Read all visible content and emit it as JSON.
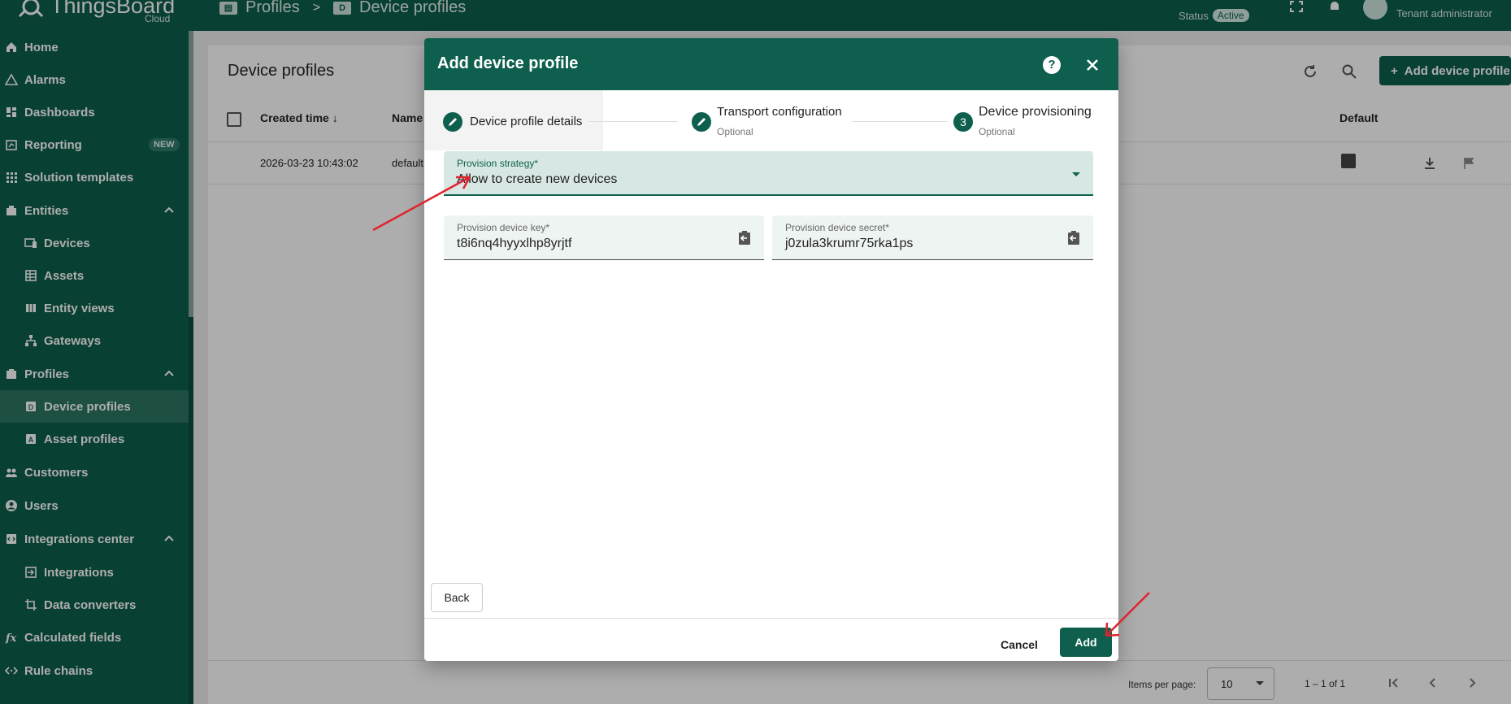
{
  "app": {
    "logo_text": "ThingsBoard",
    "logo_sub": "Cloud",
    "breadcrumb": [
      {
        "label": "Profiles",
        "icon": "profiles-icon"
      },
      {
        "label": "Device profiles",
        "icon": "device-profile-icon",
        "icon_letter": "D"
      }
    ],
    "status_label": "Status",
    "status_value": "Active",
    "user_role": "Tenant administrator",
    "brand_color": "#0e5f4d"
  },
  "sidebar": {
    "items": [
      {
        "label": "Home",
        "icon": "home-icon"
      },
      {
        "label": "Alarms",
        "icon": "alarm-icon"
      },
      {
        "label": "Dashboards",
        "icon": "dashboard-icon"
      },
      {
        "label": "Reporting",
        "icon": "reporting-icon",
        "badge": "NEW"
      },
      {
        "label": "Solution templates",
        "icon": "apps-icon"
      },
      {
        "label": "Entities",
        "icon": "entities-icon",
        "expanded": true
      },
      {
        "label": "Devices",
        "icon": "devices-icon"
      },
      {
        "label": "Assets",
        "icon": "assets-icon"
      },
      {
        "label": "Entity views",
        "icon": "entity-views-icon"
      },
      {
        "label": "Gateways",
        "icon": "gateways-icon"
      },
      {
        "label": "Profiles",
        "icon": "profiles-icon",
        "expanded": true
      },
      {
        "label": "Device profiles",
        "icon": "device-profile-icon",
        "active": true
      },
      {
        "label": "Asset profiles",
        "icon": "asset-profile-icon"
      },
      {
        "label": "Customers",
        "icon": "customers-icon"
      },
      {
        "label": "Users",
        "icon": "users-icon"
      },
      {
        "label": "Integrations center",
        "icon": "integrations-center-icon",
        "expanded": true
      },
      {
        "label": "Integrations",
        "icon": "integrations-icon"
      },
      {
        "label": "Data converters",
        "icon": "data-converters-icon"
      },
      {
        "label": "Calculated fields",
        "icon": "calculated-fields-icon"
      },
      {
        "label": "Rule chains",
        "icon": "rule-chains-icon"
      }
    ]
  },
  "page": {
    "title": "Device profiles",
    "add_button": "Add device profile",
    "columns": {
      "created": "Created time",
      "name": "Name",
      "default": "Default"
    },
    "rows": [
      {
        "created": "2026-03-23 10:43:02",
        "name": "default",
        "default": true
      }
    ],
    "paginator": {
      "items_per_page_label": "Items per page:",
      "items_per_page": "10",
      "range": "1 – 1 of 1"
    }
  },
  "dialog": {
    "title": "Add device profile",
    "steps": [
      {
        "label": "Device profile details",
        "sub": "",
        "marker": "edit"
      },
      {
        "label": "Transport configuration",
        "sub": "Optional",
        "marker": "edit"
      },
      {
        "label": "Device provisioning",
        "sub": "Optional",
        "marker": "3"
      }
    ],
    "provision_strategy": {
      "label": "Provision strategy*",
      "value": "Allow to create new devices"
    },
    "provision_key": {
      "label": "Provision device key*",
      "value": "t8i6nq4hyyxlhp8yrjtf"
    },
    "provision_secret": {
      "label": "Provision device secret*",
      "value": "j0zula3krumr75rka1ps"
    },
    "back_label": "Back",
    "cancel_label": "Cancel",
    "add_label": "Add"
  }
}
